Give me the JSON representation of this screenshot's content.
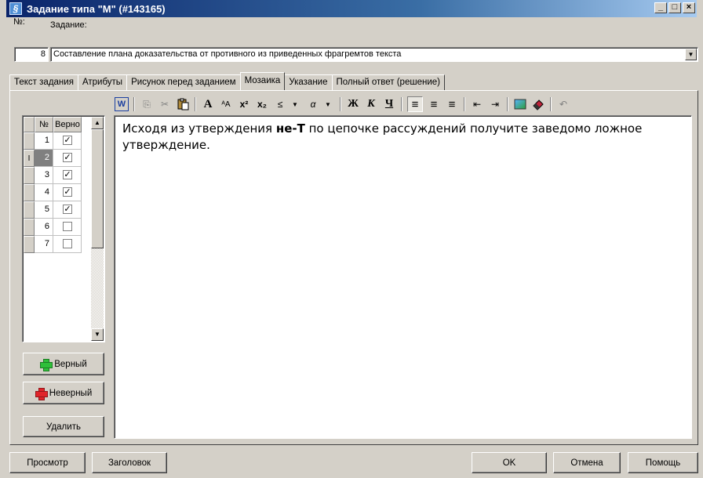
{
  "window": {
    "title": "Задание типа \"M\" (#143165)",
    "buttons": {
      "minimize": "_",
      "maximize": "□",
      "close": "×"
    }
  },
  "header": {
    "number_label": "№:",
    "number_value": "8",
    "task_label": "Задание:",
    "task_value": "Составление плана доказательства от противного из приведенных фрагремтов текста"
  },
  "tabs": [
    {
      "label": "Текст задания",
      "active": false
    },
    {
      "label": "Атрибуты",
      "active": false
    },
    {
      "label": "Рисунок перед заданием",
      "active": false
    },
    {
      "label": "Мозаика",
      "active": true
    },
    {
      "label": "Указание",
      "active": false
    },
    {
      "label": "Полный ответ (решение)",
      "active": false
    }
  ],
  "grid": {
    "columns": [
      "№",
      "Верно"
    ],
    "rows": [
      {
        "num": "1",
        "checked": true,
        "current": false
      },
      {
        "num": "2",
        "checked": true,
        "current": true
      },
      {
        "num": "3",
        "checked": true,
        "current": false
      },
      {
        "num": "4",
        "checked": true,
        "current": false
      },
      {
        "num": "5",
        "checked": true,
        "current": false
      },
      {
        "num": "6",
        "checked": false,
        "current": false
      },
      {
        "num": "7",
        "checked": false,
        "current": false
      }
    ],
    "current_marker": "I"
  },
  "left_buttons": {
    "correct": "Верный",
    "incorrect": "Неверный",
    "delete": "Удалить"
  },
  "toolbar": {
    "word_icon": "W",
    "copy_icon": "⎘",
    "cut_icon": "✂",
    "paste_icon": "📋",
    "font_icon": "A",
    "font_size_icon": "ᴬA",
    "superscript": "x²",
    "subscript": "x₂",
    "symbol": "≤",
    "greek": "α",
    "bold": "Ж",
    "italic": "К",
    "underline": "Ч",
    "align_left": "≡",
    "align_center": "≡",
    "align_right": "≡",
    "indent_less": "⇤",
    "indent_more": "⇥",
    "image_icon": "▣",
    "eraser_icon": "✎",
    "undo_icon": "↶"
  },
  "editor": {
    "text_before": "Исходя из утверждения ",
    "text_bold": "не-Т",
    "text_after": " по цепочке рассуждений получите заведомо ложное утверждение."
  },
  "bottom_buttons": {
    "preview": "Просмотр",
    "header": "Заголовок",
    "ok": "OK",
    "cancel": "Отмена",
    "help": "Помощь"
  },
  "colors": {
    "title_bar": "#0a246a",
    "correct_plus": "#2fbf3a",
    "incorrect_plus": "#e0242a"
  }
}
